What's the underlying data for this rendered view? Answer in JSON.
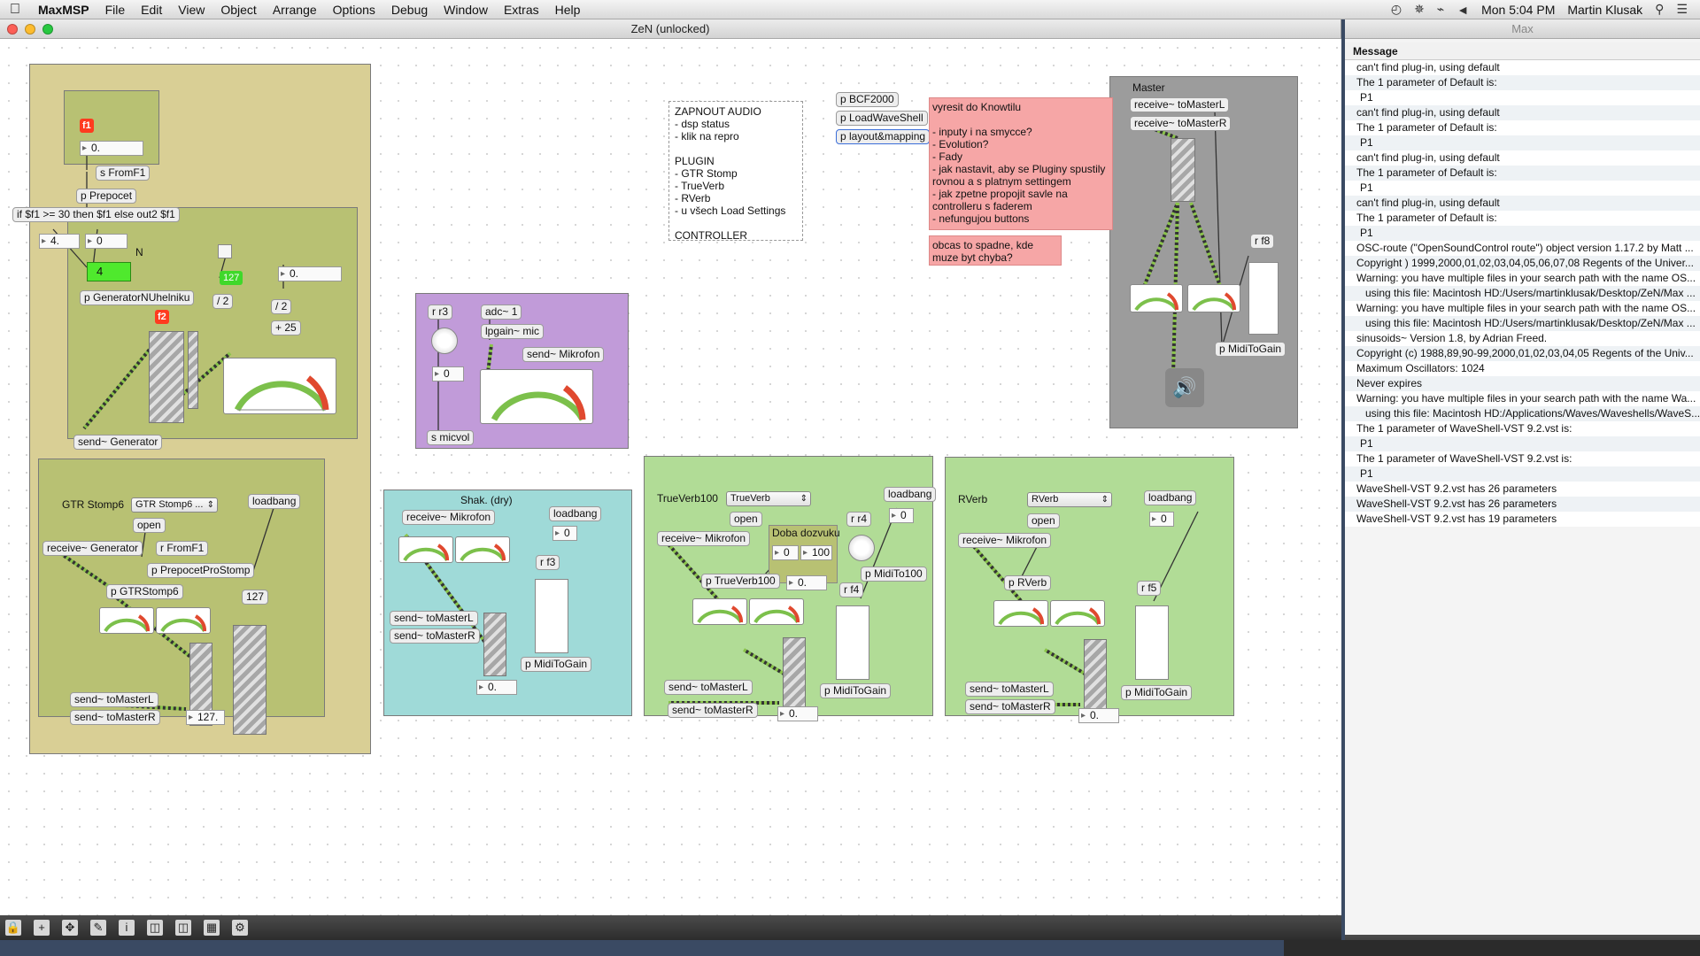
{
  "menubar": {
    "apple": "",
    "app_name": "MaxMSP",
    "items": [
      "File",
      "Edit",
      "View",
      "Object",
      "Arrange",
      "Options",
      "Debug",
      "Window",
      "Extras",
      "Help"
    ],
    "clock": "Mon 5:04 PM",
    "user": "Martin Klusak"
  },
  "patcher": {
    "title": "ZeN (unlocked)",
    "objects": {
      "f1_msg": "f1",
      "num_0": "0.",
      "s_fromf1": "s FromF1",
      "p_prepocet": "p Prepocet",
      "if_expr": "if $f1 >= 30 then $f1 else out2 $f1",
      "num_4": "4.",
      "num_0b": "0",
      "n_label": "N",
      "green_4": "4",
      "num_127": "127",
      "num_0c": "0.",
      "div2a": "/ 2",
      "div2b": "/ 2",
      "plus25": "+ 25",
      "p_gen": "p GeneratorNUhelniku",
      "f2_msg": "f2",
      "send_gen": "send~ Generator",
      "r_r3": "r r3",
      "adc": "adc~ 1",
      "lpgain": "lpgain~ mic",
      "send_mik": "send~ Mikrofon",
      "num_mic": "0",
      "s_micvol": "s micvol",
      "note_audio": "ZAPNOUT AUDIO\n- dsp status\n- klik na repro\n\nPLUGIN\n- GTR Stomp\n- TrueVerb\n- RVerb\n- u všech Load Settings\n\nCONTROLLER",
      "p_bcf": "p BCF2000",
      "p_loadwave": "p LoadWaveShell",
      "p_layout": "p layout&mapping",
      "note_todo": "vyresit do Knowtilu\n\n- inputy i na smycce?\n- Evolution?\n- Fady\n- jak nastavit, aby se Pluginy spustily\nrovnou a s platnym settingem\n- jak zpetne propojit savle na\ncontrolleru s faderem\n- nefungujou buttons",
      "note_crash": "obcas to spadne, kde\nmuze byt chyba?",
      "master_label": "Master",
      "recv_l": "receive~ toMasterL",
      "recv_r": "receive~ toMasterR",
      "r_f8": "r f8",
      "p_miditogain_m": "p MidiToGain",
      "gtr_label": "GTR Stomp6",
      "gtr_menu": "GTR Stomp6 ...",
      "loadbang1": "loadbang",
      "open1": "open",
      "recv_gen": "receive~ Generator",
      "r_fromf1": "r FromF1",
      "p_prepocet_stomp": "p PrepocetProStomp",
      "p_gtrstomp": "p GTRStomp6",
      "num_127b": "127",
      "send_ml1": "send~ toMasterL",
      "send_mr1": "send~ toMasterR",
      "num_127c": "127.",
      "shak_label": "Shak. (dry)",
      "recv_mik1": "receive~ Mikrofon",
      "loadbang2": "loadbang",
      "num_lb2": "0",
      "r_f3": "r f3",
      "send_ml2": "send~ toMasterL",
      "send_mr2": "send~ toMasterR",
      "p_mtg2": "p MidiToGain",
      "num_s2": "0.",
      "tv_label": "TrueVerb100",
      "tv_menu": "TrueVerb",
      "open2": "open",
      "doba": "Doba dozvuku",
      "num_d0": "0",
      "num_d100": "100",
      "r_r4": "r r4",
      "loadbang3": "loadbang",
      "num_lb3": "0",
      "recv_mik2": "receive~ Mikrofon",
      "p_trueverb": "p TrueVerb100",
      "num_tv": "0.",
      "r_f4": "r f4",
      "p_midi100": "p MidiTo100",
      "send_ml3": "send~ toMasterL",
      "send_mr3": "send~ toMasterR",
      "p_mtg3": "p MidiToGain",
      "num_s3": "0.",
      "rv_label": "RVerb",
      "rv_menu": "RVerb",
      "open3": "open",
      "loadbang4": "loadbang",
      "num_lb4": "0",
      "recv_mik3": "receive~ Mikrofon",
      "p_rverb": "p RVerb",
      "r_f5": "r f5",
      "send_ml4": "send~ toMasterL",
      "send_mr4": "send~ toMasterR",
      "p_mtg4": "p MidiToGain",
      "num_s4": "0."
    }
  },
  "console": {
    "title": "Max",
    "header": "Message",
    "messages": [
      "can't find plug-in, using default",
      "The 1 parameter of Default is:",
      "P1",
      "can't find plug-in, using default",
      "The 1 parameter of Default is:",
      "P1",
      "can't find plug-in, using default",
      "The 1 parameter of Default is:",
      "P1",
      "can't find plug-in, using default",
      "The 1 parameter of Default is:",
      "P1",
      "OSC-route (\"OpenSoundControl route\") object version 1.17.2 by Matt ...",
      "Copyright ) 1999,2000,01,02,03,04,05,06,07,08 Regents of the Univer...",
      "Warning: you have multiple files in your search path with the name OS...",
      "using this file: Macintosh HD:/Users/martinklusak/Desktop/ZeN/Max ...",
      "Warning: you have multiple files in your search path with the name OS...",
      "using this file: Macintosh HD:/Users/martinklusak/Desktop/ZeN/Max ...",
      "sinusoids~ Version 1.8, by Adrian Freed.",
      "Copyright (c) 1988,89,90-99,2000,01,02,03,04,05 Regents of the Univ...",
      "Maximum Oscillators: 1024",
      "Never expires",
      "Warning: you have multiple files in your search path with the name Wa...",
      "using this file: Macintosh HD:/Applications/Waves/Waveshells/WaveS...",
      "The 1 parameter of WaveShell-VST 9.2.vst is:",
      "P1",
      "The 1 parameter of WaveShell-VST 9.2.vst is:",
      "P1",
      "WaveShell-VST 9.2.vst has 26 parameters",
      "WaveShell-VST 9.2.vst has 26 parameters",
      "WaveShell-VST 9.2.vst has 19 parameters"
    ]
  },
  "colors": {
    "panel_tan": "#d9cf95",
    "panel_olive": "#b8c173",
    "panel_purple": "#c19bd9",
    "panel_teal": "#9fdad8",
    "panel_green": "#b1dc96",
    "panel_gray": "#9c9c9c",
    "note_pink": "#f6a6a6"
  }
}
